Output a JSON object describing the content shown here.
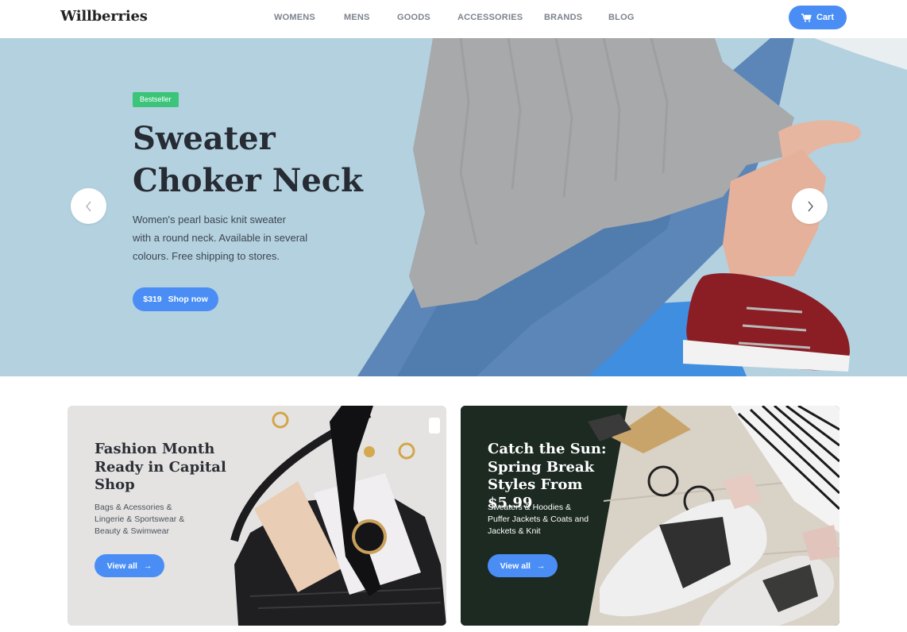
{
  "header": {
    "logo": "Willberries",
    "nav": [
      "WOMENS",
      "MENS",
      "GOODS",
      "ACCESSORIES",
      "BRANDS",
      "BLOG"
    ],
    "cart_label": "Cart",
    "cart_icon": "cart-icon"
  },
  "hero": {
    "badge": "Bestseller",
    "title_line1": "Sweater",
    "title_line2": "Choker Neck",
    "desc_line1": "Women's pearl basic knit sweater",
    "desc_line2": "with a round neck. Available in several",
    "desc_line3": "colours. Free shipping to stores.",
    "price": "$319",
    "cta": "Shop now",
    "prev_icon": "chevron-left-icon",
    "next_icon": "chevron-right-icon"
  },
  "cards": [
    {
      "title_line1": "Fashion Month",
      "title_line2": "Ready in Capital",
      "title_line3": "Shop",
      "sub_line1": "Bags & Acessories &",
      "sub_line2": "Lingerie & Sportswear &",
      "sub_line3": "Beauty & Swimwear",
      "cta": "View all",
      "arrow": "→"
    },
    {
      "title_line1": "Catch the Sun:",
      "title_line2": "Spring Break",
      "title_line3": "Styles From $5.99",
      "sub_line1": "Sweaters & Hoodies &",
      "sub_line2": "Puffer Jackets & Coats and",
      "sub_line3": "Jackets & Knit",
      "cta": "View all",
      "arrow": "→"
    }
  ],
  "colors": {
    "accent": "#4a8ef5",
    "badge": "#3cc57a",
    "hero_bg": "#b3d1df"
  }
}
